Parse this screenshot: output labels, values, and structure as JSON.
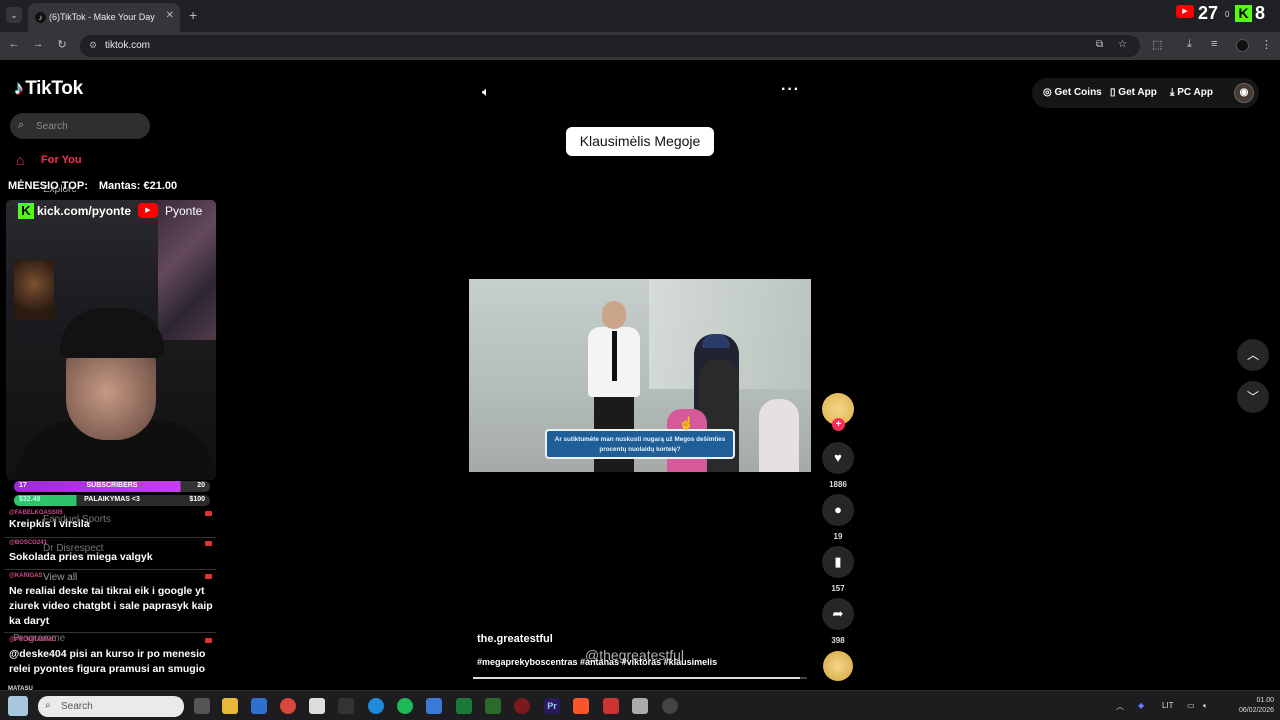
{
  "browser": {
    "tab_title": "(6)TikTok - Make Your Day",
    "url": "tiktok.com",
    "overlay_counts": {
      "youtube": "27",
      "kick": "8",
      "small": "0"
    }
  },
  "tiktok": {
    "logo": "TikTok",
    "search_placeholder": "Search",
    "nav_for_you": "For You",
    "nav_ghost": [
      "Explore",
      "Fanduel Sports",
      "Dr Disrespect",
      "View all",
      "Programme"
    ],
    "top_actions": {
      "coins": "Get Coins",
      "app": "Get App",
      "pc": "PC App"
    },
    "question_pill": "Klausimėlis Megoje",
    "video_caption": "Ar sutiktumėte man nuskusti nugarą už Megos dešimties procentų nuolaidų kortelę?",
    "video_progress": 0.98,
    "username": "the.greatestful",
    "watermark": "@thegreatestful",
    "hashtags": "#megaprekyboscentras #antanas #viktoras #klausimelis",
    "likes": "1886",
    "comments": "19",
    "saves": "157",
    "shares": "398"
  },
  "stream_overlay": {
    "top_label": "MĖNESIO TOP:",
    "top_value": "Mantas: €21.00",
    "kick_url": "kick.com/pyonte",
    "youtube_name": "Pyonte",
    "subs_left": "17",
    "subs_label": "SUBSCRIBERS",
    "subs_right": "20",
    "subs_progress": 0.85,
    "donate_left": "$32.49",
    "donate_label": "PALAIKYMAS <3",
    "donate_right": "$100",
    "donate_progress": 0.32,
    "chat": [
      {
        "user": "@FABELKOASS05",
        "text": "Kreipkis i virsila"
      },
      {
        "user": "@BOSCO241",
        "text": "Sokolada pries miega valgyk"
      },
      {
        "user": "@KARIGAS",
        "text": "Ne realiai deske tai tikrai eik i google yt ziurek video chatgbt i sale paprasyk kaip ka daryt"
      },
      {
        "user": "@PROGRAMME",
        "text": "@deske404 pisi an kurso ir po menesio relei pyontes figura pramusi an smugio"
      }
    ],
    "bottom_user": "MATASU"
  },
  "taskbar": {
    "search_placeholder": "Search",
    "lang": "LIT",
    "time": "01.00",
    "date": "06/02/2026"
  }
}
